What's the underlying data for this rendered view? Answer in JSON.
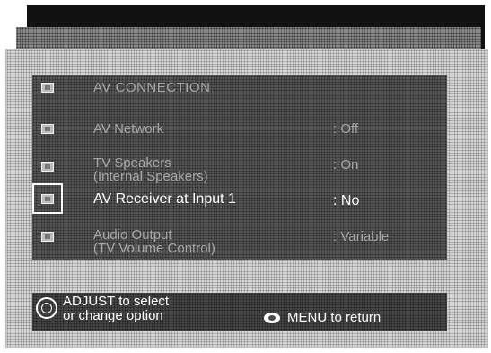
{
  "menu": {
    "title": "AV CONNECTION",
    "items": [
      {
        "label": "AV Network",
        "label2": "",
        "value": ": Off",
        "active": false
      },
      {
        "label": "TV Speakers",
        "label2": "(Internal Speakers)",
        "value": ": On",
        "active": false
      },
      {
        "label": "AV Receiver at Input 1",
        "label2": "",
        "value": ": No",
        "active": true
      },
      {
        "label": "Audio Output",
        "label2": "(TV Volume Control)",
        "value": ": Variable",
        "active": false
      }
    ]
  },
  "help": {
    "adjust_line1": "ADJUST  to select",
    "adjust_line2": "or change option",
    "menu_return": "MENU to return"
  },
  "icons": {
    "title": "av-connection-icon",
    "row": "menu-item-icon",
    "adjust": "dpad-icon",
    "menu": "menu-button-icon"
  }
}
